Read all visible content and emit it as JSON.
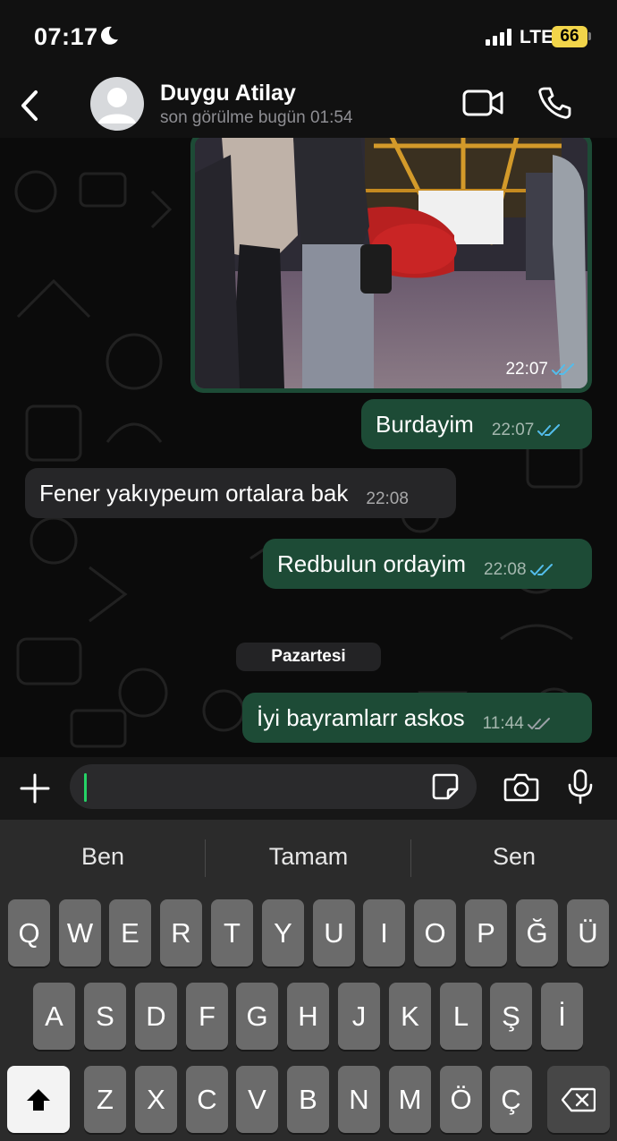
{
  "status_bar": {
    "time": "07:17",
    "network": "LTE",
    "battery": "66"
  },
  "header": {
    "contact_name": "Duygu Atilay",
    "last_seen": "son görülme bugün 01:54"
  },
  "messages": [
    {
      "type": "image",
      "direction": "out",
      "time": "22:07",
      "status": "read"
    },
    {
      "type": "text",
      "direction": "out",
      "text": "Burdayim",
      "time": "22:07",
      "status": "read"
    },
    {
      "type": "text",
      "direction": "in",
      "text": "Fener yakıypeum ortalara bak",
      "time": "22:08"
    },
    {
      "type": "text",
      "direction": "out",
      "text": "Redbulun ordayim",
      "time": "22:08",
      "status": "read"
    },
    {
      "type": "date_divider",
      "text": "Pazartesi"
    },
    {
      "type": "text",
      "direction": "out",
      "text": "İyi bayramlarr askos",
      "time": "11:44",
      "status": "delivered"
    }
  ],
  "composer": {
    "value": "",
    "placeholder": ""
  },
  "keyboard": {
    "predictions": [
      "Ben",
      "Tamam",
      "Sen"
    ],
    "row1": [
      "Q",
      "W",
      "E",
      "R",
      "T",
      "Y",
      "U",
      "I",
      "O",
      "P",
      "Ğ",
      "Ü"
    ],
    "row2": [
      "A",
      "S",
      "D",
      "F",
      "G",
      "H",
      "J",
      "K",
      "L",
      "Ş",
      "İ"
    ],
    "row3": [
      "Z",
      "X",
      "C",
      "V",
      "B",
      "N",
      "M",
      "Ö",
      "Ç"
    ]
  },
  "colors": {
    "outgoing_bubble": "#1d4b36",
    "incoming_bubble": "#262628",
    "read_tick": "#53bdeb",
    "delivered_tick": "#9aa0a6",
    "battery": "#f2d54a"
  },
  "icons": [
    "moon-icon",
    "signal-icon",
    "back-icon",
    "avatar-icon",
    "video-call-icon",
    "phone-icon",
    "double-tick-icon",
    "plus-icon",
    "sticker-icon",
    "camera-icon",
    "mic-icon",
    "shift-icon",
    "backspace-icon"
  ]
}
